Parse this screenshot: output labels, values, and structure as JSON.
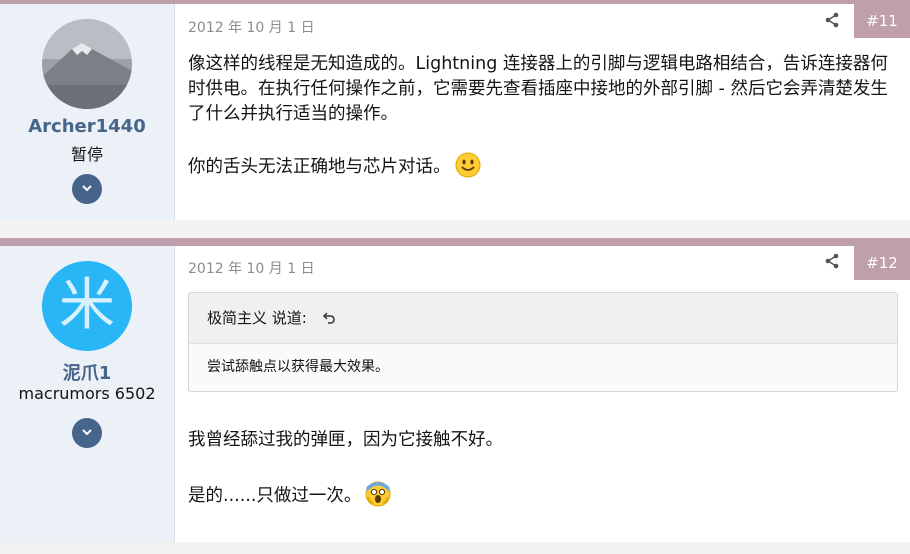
{
  "posts": [
    {
      "author": "Archer1440",
      "user_title": "暂停",
      "date": "2012 年 10 月 1 日",
      "number": "#11",
      "paragraph1": "像这样的线程是无知造成的。Lightning 连接器上的引脚与逻辑电路相结合，告诉连接器何时供电。在执行任何操作之前，它需要先查看插座中接地的外部引脚 - 然后它会弄清楚发生了什么并执行适当的操作。",
      "paragraph2": "你的舌头无法正确地与芯片对话。",
      "emoji": "smile-emoji"
    },
    {
      "author": "泥爪1",
      "user_title": "macrumors 6502",
      "avatar_glyph": "米",
      "date": "2012 年 10 月 1 日",
      "number": "#12",
      "quote_author": "极简主义 说道:",
      "quote_text": "尝试舔触点以获得最大效果。",
      "paragraph1": "我曾经舔过我的弹匣，因为它接触不好。",
      "paragraph2": "是的......只做过一次。",
      "emoji": "scream-emoji"
    }
  ],
  "icons": {
    "share": "share-icon",
    "expand": "chevron-down-icon",
    "jump": "arrow-up-icon"
  },
  "colors": {
    "accent": "#c09fad",
    "username": "#47648a",
    "sidebar_bg": "#ecf1f7",
    "avatar2_bg": "#29b6f6"
  }
}
